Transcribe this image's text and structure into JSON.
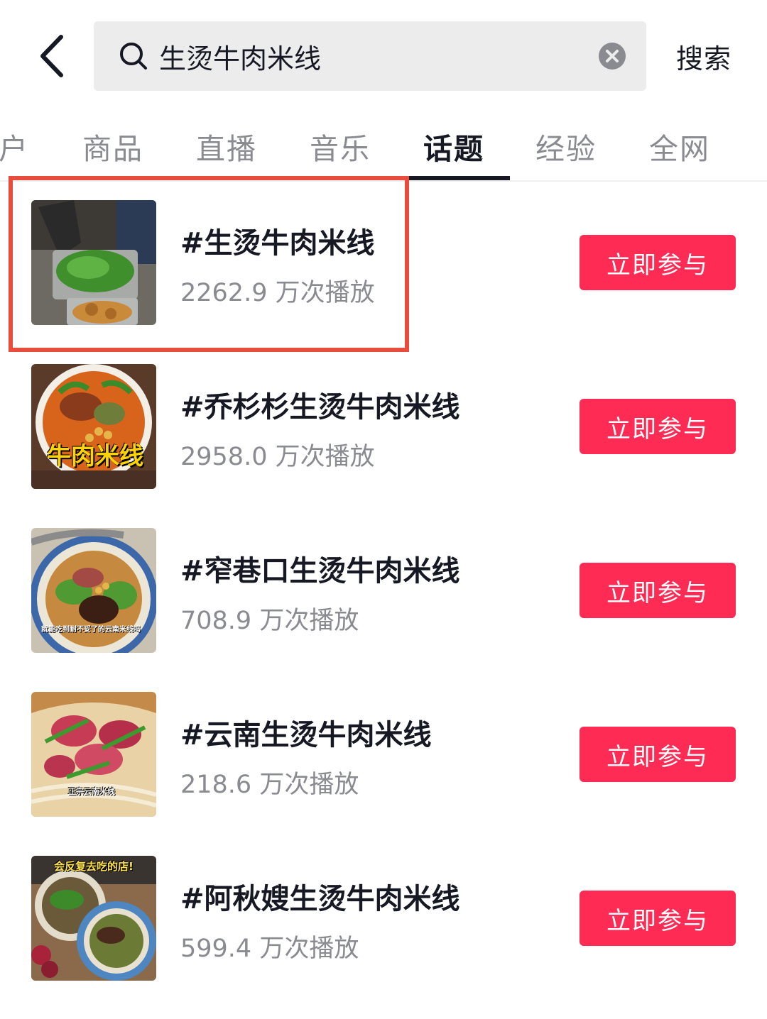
{
  "header": {
    "search_value": "生烫牛肉米线",
    "search_button_label": "搜索"
  },
  "tabs": [
    {
      "label": "户"
    },
    {
      "label": "商品"
    },
    {
      "label": "直播"
    },
    {
      "label": "音乐"
    },
    {
      "label": "话题",
      "active": true
    },
    {
      "label": "经验"
    },
    {
      "label": "全网"
    }
  ],
  "results": [
    {
      "title": "#生烫牛肉米线",
      "plays": "2262.9 万次播放",
      "join_label": "立即参与",
      "highlighted": true
    },
    {
      "title": "#乔杉杉生烫牛肉米线",
      "plays": "2958.0 万次播放",
      "join_label": "立即参与",
      "thumb_caption": "牛肉米线"
    },
    {
      "title": "#窄巷口生烫牛肉米线",
      "plays": "708.9 万次播放",
      "join_label": "立即参与",
      "thumb_caption": "就能吃到耐不妥了的云南米线吗"
    },
    {
      "title": "#云南生烫牛肉米线",
      "plays": "218.6 万次播放",
      "join_label": "立即参与",
      "thumb_caption": "正宗云南米线"
    },
    {
      "title": "#阿秋嫂生烫牛肉米线",
      "plays": "599.4 万次播放",
      "join_label": "立即参与",
      "thumb_caption": "会反复去吃的店!"
    }
  ],
  "colors": {
    "accent": "#fe2c55",
    "highlight_border": "#e74c3c",
    "text_primary": "#161823",
    "text_secondary": "#8a8b91",
    "search_bg": "#ececed"
  }
}
